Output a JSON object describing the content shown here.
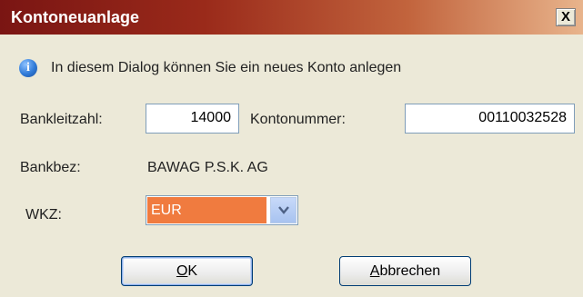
{
  "window": {
    "title": "Kontoneuanlage",
    "close_label": "X"
  },
  "info": {
    "icon": "info-icon",
    "text": "In diesem Dialog können Sie ein neues Konto anlegen"
  },
  "form": {
    "bankleitzahl_label": "Bankleitzahl:",
    "bankleitzahl_value": "14000",
    "kontonummer_label": "Kontonummer:",
    "kontonummer_value": "00110032528",
    "bankbez_label": "Bankbez:",
    "bankbez_value": "BAWAG P.S.K. AG",
    "wkz_label": "WKZ:",
    "wkz_value": "EUR"
  },
  "buttons": {
    "ok_mnemonic": "O",
    "ok_rest": "K",
    "cancel_mnemonic": "A",
    "cancel_rest": "bbrechen"
  },
  "colors": {
    "titlebar_start": "#7a1513",
    "titlebar_end": "#e8b48c",
    "dialog_bg": "#ece9d8",
    "select_highlight": "#f07b3f"
  }
}
